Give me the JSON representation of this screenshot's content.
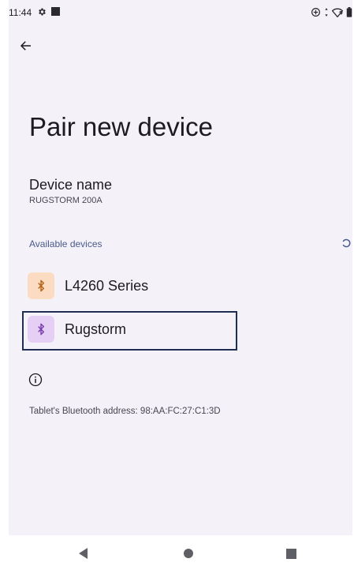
{
  "status_bar": {
    "time": "11:44",
    "icons": [
      "gear-icon",
      "notification-square-icon",
      "data-saver-icon",
      "data-arrows-icon",
      "wifi-question-icon",
      "battery-icon"
    ]
  },
  "header": {
    "back_icon": "arrow-back-icon",
    "title": "Pair new device"
  },
  "device_name": {
    "label": "Device name",
    "value": "RUGSTORM 200A"
  },
  "available_devices": {
    "header": "Available devices",
    "scanning_icon": "progress-spinner-icon",
    "items": [
      {
        "label": "L4260 Series",
        "icon": "bluetooth-icon",
        "icon_bg": "#fbdcc2",
        "icon_color": "#b5651d"
      },
      {
        "label": "Rugstorm",
        "icon": "bluetooth-icon",
        "icon_bg": "#e6cff4",
        "icon_color": "#7a3fb0"
      }
    ]
  },
  "footer": {
    "info_icon": "info-icon",
    "address_text": "Tablet's Bluetooth address: 98:AA:FC:27:C1:3D"
  },
  "nav_bar": {
    "icons": [
      "nav-back-icon",
      "nav-home-icon",
      "nav-recents-icon"
    ]
  },
  "colors": {
    "background": "#f4f2f8",
    "accent": "#4a5a8c",
    "focus_border": "#1f2f54"
  }
}
